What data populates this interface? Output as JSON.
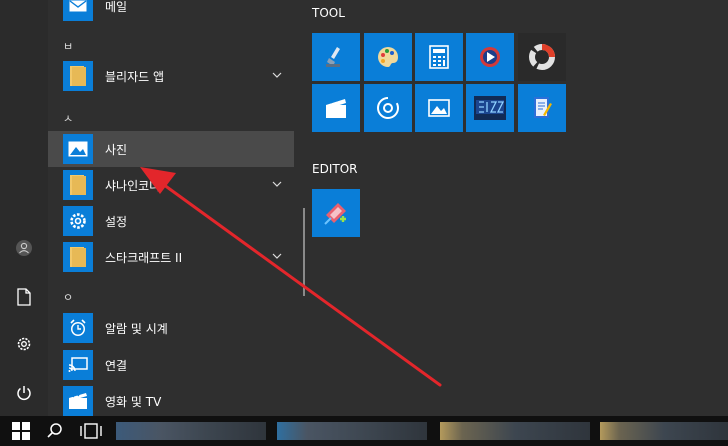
{
  "app_list": {
    "items": [
      {
        "label": "메일",
        "icon": "mail-icon",
        "has_chevron": false
      },
      {
        "label": "블리자드 앱",
        "icon": "folder-icon",
        "has_chevron": true
      },
      {
        "label": "사진",
        "icon": "photos-icon",
        "has_chevron": false,
        "selected": true
      },
      {
        "label": "샤나인코더",
        "icon": "folder-icon",
        "has_chevron": true
      },
      {
        "label": "설정",
        "icon": "gear-icon",
        "has_chevron": false
      },
      {
        "label": "스타크래프트 II",
        "icon": "folder-icon",
        "has_chevron": true
      },
      {
        "label": "알람 및 시계",
        "icon": "alarm-clock-icon",
        "has_chevron": false
      },
      {
        "label": "연결",
        "icon": "connect-icon",
        "has_chevron": false
      },
      {
        "label": "영화 및 TV",
        "icon": "movies-icon",
        "has_chevron": false
      }
    ],
    "section_letters": [
      "ㅂ",
      "ㅅ",
      "ㅇ"
    ]
  },
  "tile_groups": [
    {
      "title": "TOOL"
    },
    {
      "title": "EDITOR"
    }
  ],
  "tiles": [
    "paint-roller-icon",
    "palette-icon",
    "calculator-icon",
    "media-player-icon",
    "donut-app-icon",
    "clapperboard-icon",
    "disc-icon",
    "photos-icon",
    "blizzard-icon",
    "notebook-icon",
    "editor-app-icon"
  ],
  "colors": {
    "accent": "#0a7ed8",
    "background": "#2f2f2f",
    "annotation_arrow": "#e3262b"
  }
}
